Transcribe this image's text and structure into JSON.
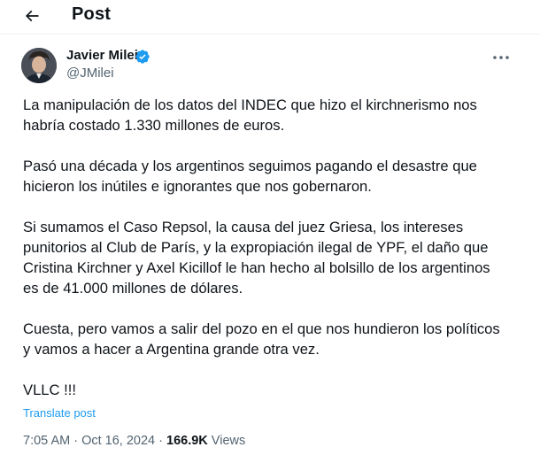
{
  "header": {
    "title": "Post",
    "back_icon": "arrow-left-icon"
  },
  "author": {
    "name": "Javier Milei",
    "handle": "@JMilei",
    "verified_color": "#1d9bf0"
  },
  "tweet": {
    "paragraphs": [
      [
        "La manipulación de los datos del INDEC que hizo el kirchnerismo nos",
        "habría costado 1.330 millones de euros."
      ],
      [
        "Pasó una década y los argentinos seguimos pagando el desastre que",
        "hicieron los inútiles e ignorantes que nos gobernaron."
      ],
      [
        "Si sumamos el Caso Repsol, la causa del juez Griesa, los intereses",
        "punitorios al Club de París, y la expropiación ilegal de YPF, el daño que",
        "Cristina Kirchner y Axel Kicillof le han hecho al bolsillo de los argentinos",
        "es de 41.000 millones de dólares."
      ],
      [
        "Cuesta, pero vamos a salir del pozo en el que nos hundieron los políticos",
        "y vamos a hacer a Argentina grande otra vez."
      ],
      [
        "VLLC !!!"
      ]
    ]
  },
  "translate_label": "Translate post",
  "meta": {
    "time": "7:05 AM",
    "separator": " · ",
    "date": "Oct 16, 2024",
    "views_count": "166.9K",
    "views_label": " Views"
  },
  "colors": {
    "link": "#1d9bf0",
    "secondary": "#536471",
    "text": "#0f1419"
  }
}
